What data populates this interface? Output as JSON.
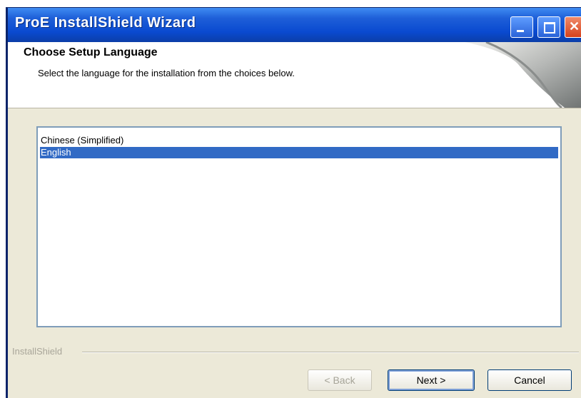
{
  "window": {
    "title": "ProE InstallShield Wizard",
    "controls": {
      "minimize_icon": "minimize-icon",
      "maximize_icon": "maximize-icon",
      "close_icon": "close-icon"
    }
  },
  "header": {
    "title": "Choose Setup Language",
    "subtitle": "Select the language for the installation from the choices below."
  },
  "language_list": {
    "items": [
      "Chinese (Simplified)",
      "English"
    ],
    "selected": "English"
  },
  "footer": {
    "brand": "InstallShield"
  },
  "buttons": {
    "back": "< Back",
    "next": "Next >",
    "cancel": "Cancel"
  },
  "colors": {
    "titlebar": "#1e5fd8",
    "selection": "#316ac5",
    "dialog_bg": "#ece9d8"
  }
}
